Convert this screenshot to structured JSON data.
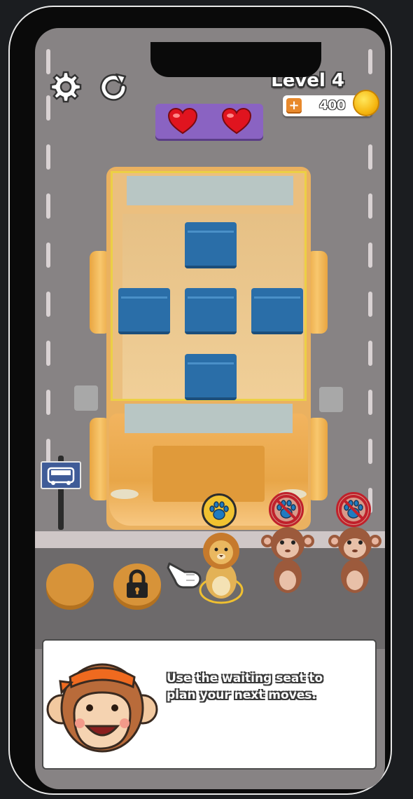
{
  "hud": {
    "settings_icon": "gear-icon",
    "restart_icon": "restart-icon",
    "level_label": "Level 4",
    "coin_add_symbol": "+",
    "coin_count": "400",
    "lives": 2
  },
  "board": {
    "bus_color": "#eab160",
    "seat_color": "#2a6ea8",
    "seats_filled": 0,
    "seat_count": 5
  },
  "queue": [
    {
      "character": "lion",
      "paw_badge": "allowed"
    },
    {
      "character": "monkey",
      "paw_badge": "banned"
    },
    {
      "character": "monkey",
      "paw_badge": "banned"
    }
  ],
  "waiting_seats": [
    {
      "state": "empty"
    },
    {
      "state": "locked"
    }
  ],
  "tutorial": {
    "message": "Use the waiting seat to plan your next moves.",
    "mascot": "monkey-mascot"
  }
}
